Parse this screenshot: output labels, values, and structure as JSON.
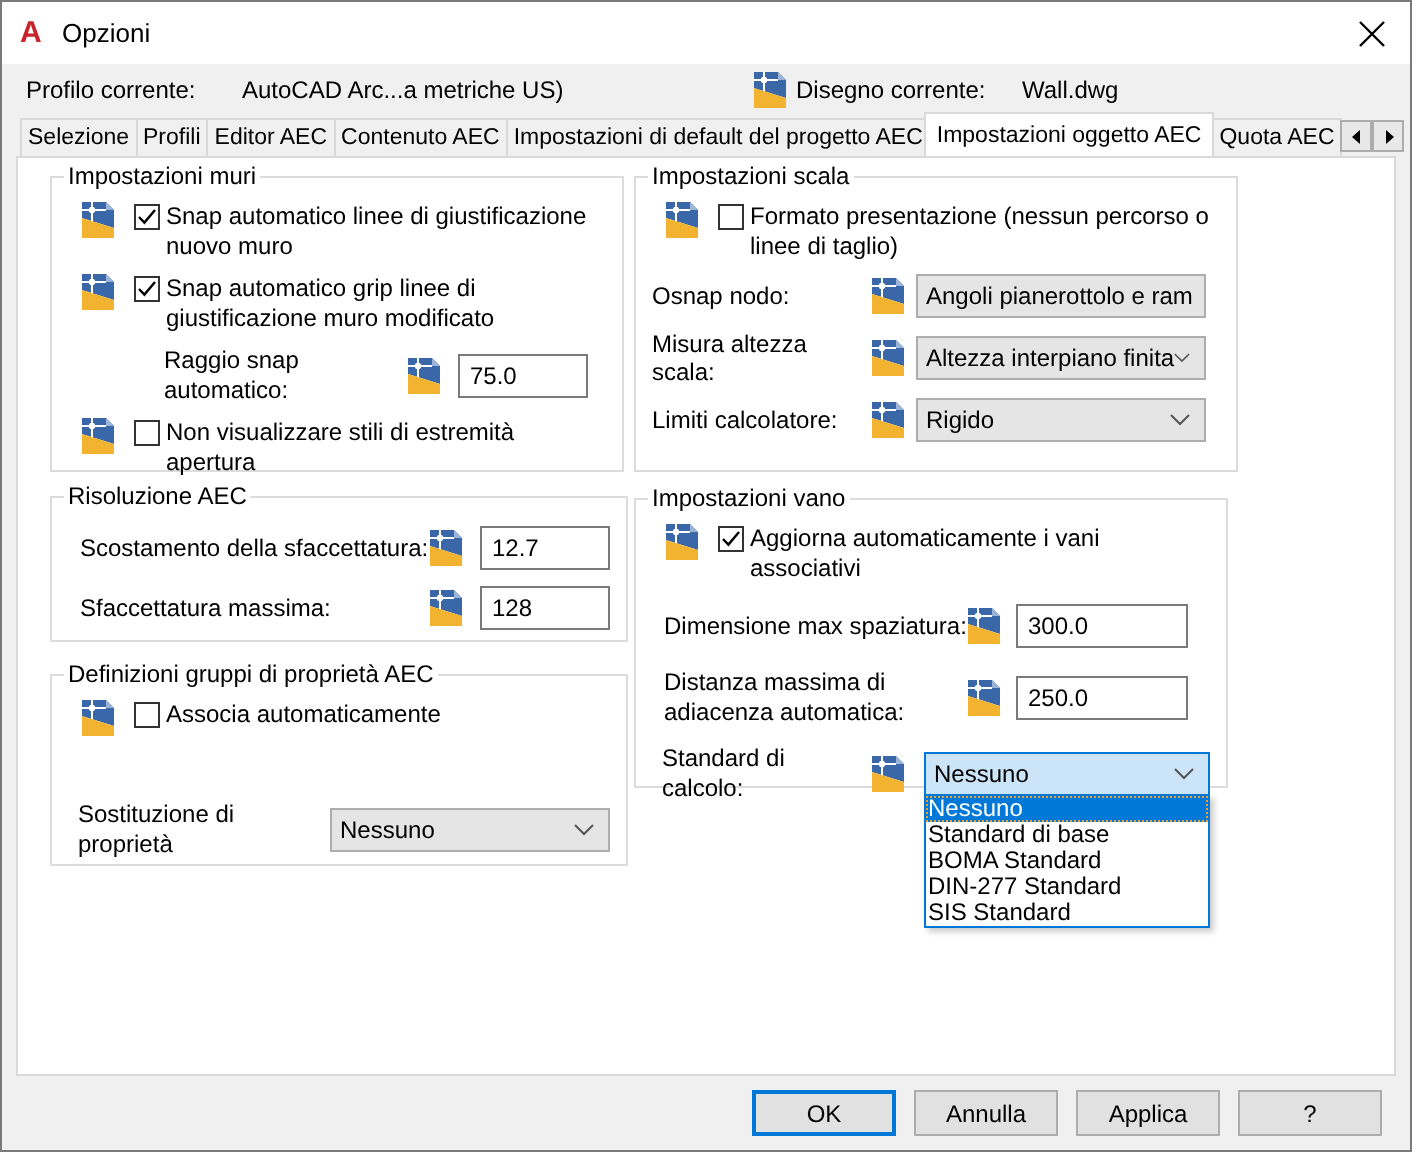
{
  "window": {
    "logo": "A",
    "title": "Opzioni"
  },
  "profile": {
    "label": "Profilo corrente:",
    "value": "AutoCAD Arc...a metriche US)"
  },
  "drawing": {
    "label": "Disegno corrente:",
    "value": "Wall.dwg"
  },
  "tabs": [
    {
      "label": "Selezione",
      "selected": false
    },
    {
      "label": "Profili",
      "selected": false
    },
    {
      "label": "Editor AEC",
      "selected": false
    },
    {
      "label": "Contenuto AEC",
      "selected": false
    },
    {
      "label": "Impostazioni di default del progetto AEC",
      "selected": false
    },
    {
      "label": "Impostazioni oggetto AEC",
      "selected": true
    },
    {
      "label": "Quota AEC",
      "selected": false
    }
  ],
  "wall_settings": {
    "title": "Impostazioni muri",
    "items": [
      {
        "kind": "checkbox",
        "label": "Snap automatico linee di giustificazione nuovo muro",
        "checked": true
      },
      {
        "kind": "checkbox",
        "label": "Snap automatico grip linee di giustificazione muro modificato",
        "checked": true
      },
      {
        "kind": "field",
        "label": "Raggio snap automatico:",
        "value": "75.0"
      },
      {
        "kind": "checkbox",
        "label": "Non visualizzare stili di estremità apertura",
        "checked": false
      }
    ]
  },
  "aec_resolution": {
    "title": "Risoluzione AEC",
    "fields": [
      {
        "label": "Scostamento della sfaccettatura:",
        "value": "12.7"
      },
      {
        "label": "Sfaccettatura massima:",
        "value": "128"
      }
    ]
  },
  "property_sets": {
    "title": "Definizioni gruppi di proprietà AEC",
    "auto_associate": {
      "label": "Associa automaticamente",
      "checked": false
    },
    "override": {
      "label": "Sostituzione di proprietà",
      "value": "Nessuno"
    }
  },
  "stair_settings": {
    "title": "Impostazioni scala",
    "presentation_format": {
      "label": "Formato presentazione (nessun percorso o linee di taglio)",
      "checked": false
    },
    "selects": [
      {
        "label": "Osnap nodo:",
        "value": "Angoli pianerottolo e ram"
      },
      {
        "label": "Misura altezza scala:",
        "value": "Altezza interpiano finita"
      },
      {
        "label": "Limiti calcolatore:",
        "value": "Rigido"
      }
    ]
  },
  "space_settings": {
    "title": "Impostazioni vano",
    "auto_update": {
      "label": "Aggiorna automaticamente i vani associativi",
      "checked": true
    },
    "fields": [
      {
        "label": "Dimensione max spaziatura:",
        "value": "300.0"
      },
      {
        "label": "Distanza massima di adiacenza automatica:",
        "value": "250.0"
      }
    ],
    "calc_standard": {
      "label": "Standard di calcolo:",
      "value": "Nessuno",
      "expanded": true,
      "options": [
        {
          "label": "Nessuno",
          "selected": true
        },
        {
          "label": "Standard di base",
          "selected": false
        },
        {
          "label": "BOMA Standard",
          "selected": false
        },
        {
          "label": "DIN-277 Standard",
          "selected": false
        },
        {
          "label": "SIS Standard",
          "selected": false
        }
      ]
    }
  },
  "buttons": [
    {
      "label": "OK",
      "default": true
    },
    {
      "label": "Annulla",
      "default": false
    },
    {
      "label": "Applica",
      "default": false
    },
    {
      "label": "?",
      "default": false
    }
  ]
}
